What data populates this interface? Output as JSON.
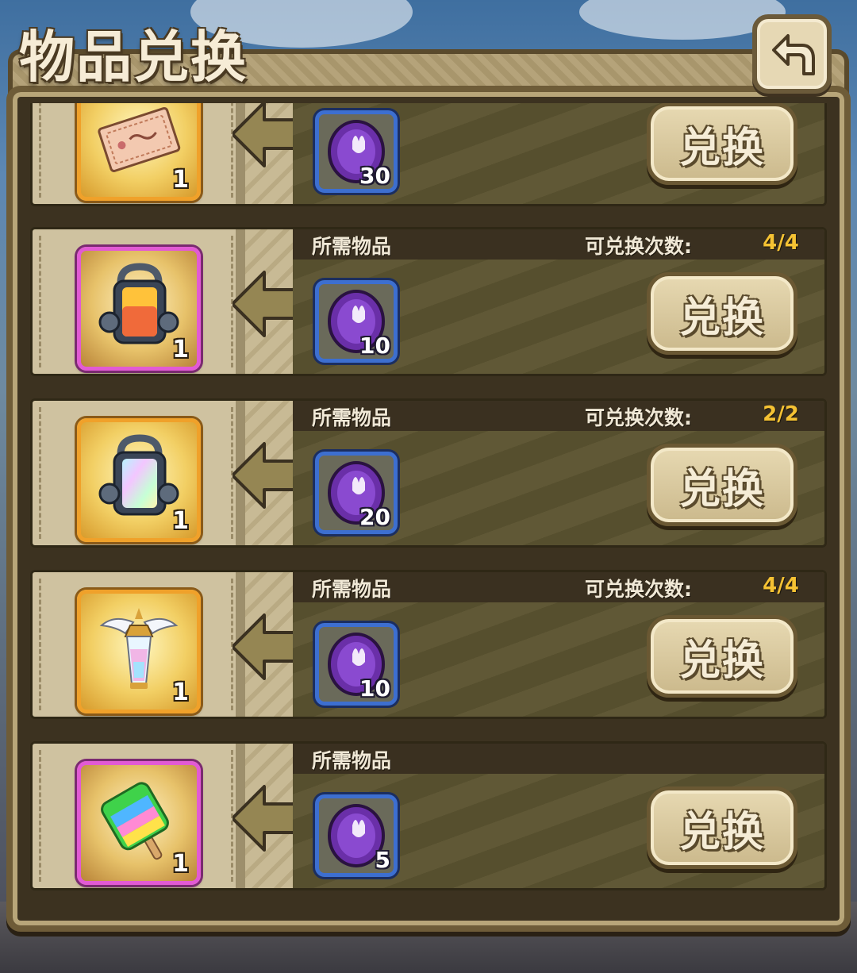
{
  "header": {
    "title": "物品兑换",
    "back_icon": "back-arrow-icon"
  },
  "labels": {
    "required_items": "所需物品",
    "exchange_limit": "可兑换次数:",
    "exchange_button": "兑换"
  },
  "colors": {
    "gold_frame": "#f0a12a",
    "purple_frame": "#e25ad4",
    "cost_frame": "#3d6fd0",
    "limit_value": "#f5c233"
  },
  "rows": [
    {
      "reward_icon": "ticket-icon",
      "reward_frame": "gold",
      "reward_qty": "1",
      "cost_icon": "rabbit-coin-icon",
      "cost_qty": "30",
      "required_label": "",
      "limit_label": "",
      "limit_value": ""
    },
    {
      "reward_icon": "lantern-capsule-icon",
      "reward_frame": "purple",
      "reward_qty": "1",
      "cost_icon": "rabbit-coin-icon",
      "cost_qty": "10",
      "required_label": "所需物品",
      "limit_label": "可兑换次数:",
      "limit_value": "4/4"
    },
    {
      "reward_icon": "rainbow-capsule-icon",
      "reward_frame": "gold",
      "reward_qty": "1",
      "cost_icon": "rabbit-coin-icon",
      "cost_qty": "20",
      "required_label": "所需物品",
      "limit_label": "可兑换次数:",
      "limit_value": "2/2"
    },
    {
      "reward_icon": "winged-lantern-icon",
      "reward_frame": "gold",
      "reward_qty": "1",
      "cost_icon": "rabbit-coin-icon",
      "cost_qty": "10",
      "required_label": "所需物品",
      "limit_label": "可兑换次数:",
      "limit_value": "4/4"
    },
    {
      "reward_icon": "rainbow-popsicle-icon",
      "reward_frame": "purple",
      "reward_qty": "1",
      "cost_icon": "rabbit-coin-icon",
      "cost_qty": "5",
      "required_label": "所需物品",
      "limit_label": "",
      "limit_value": ""
    }
  ]
}
